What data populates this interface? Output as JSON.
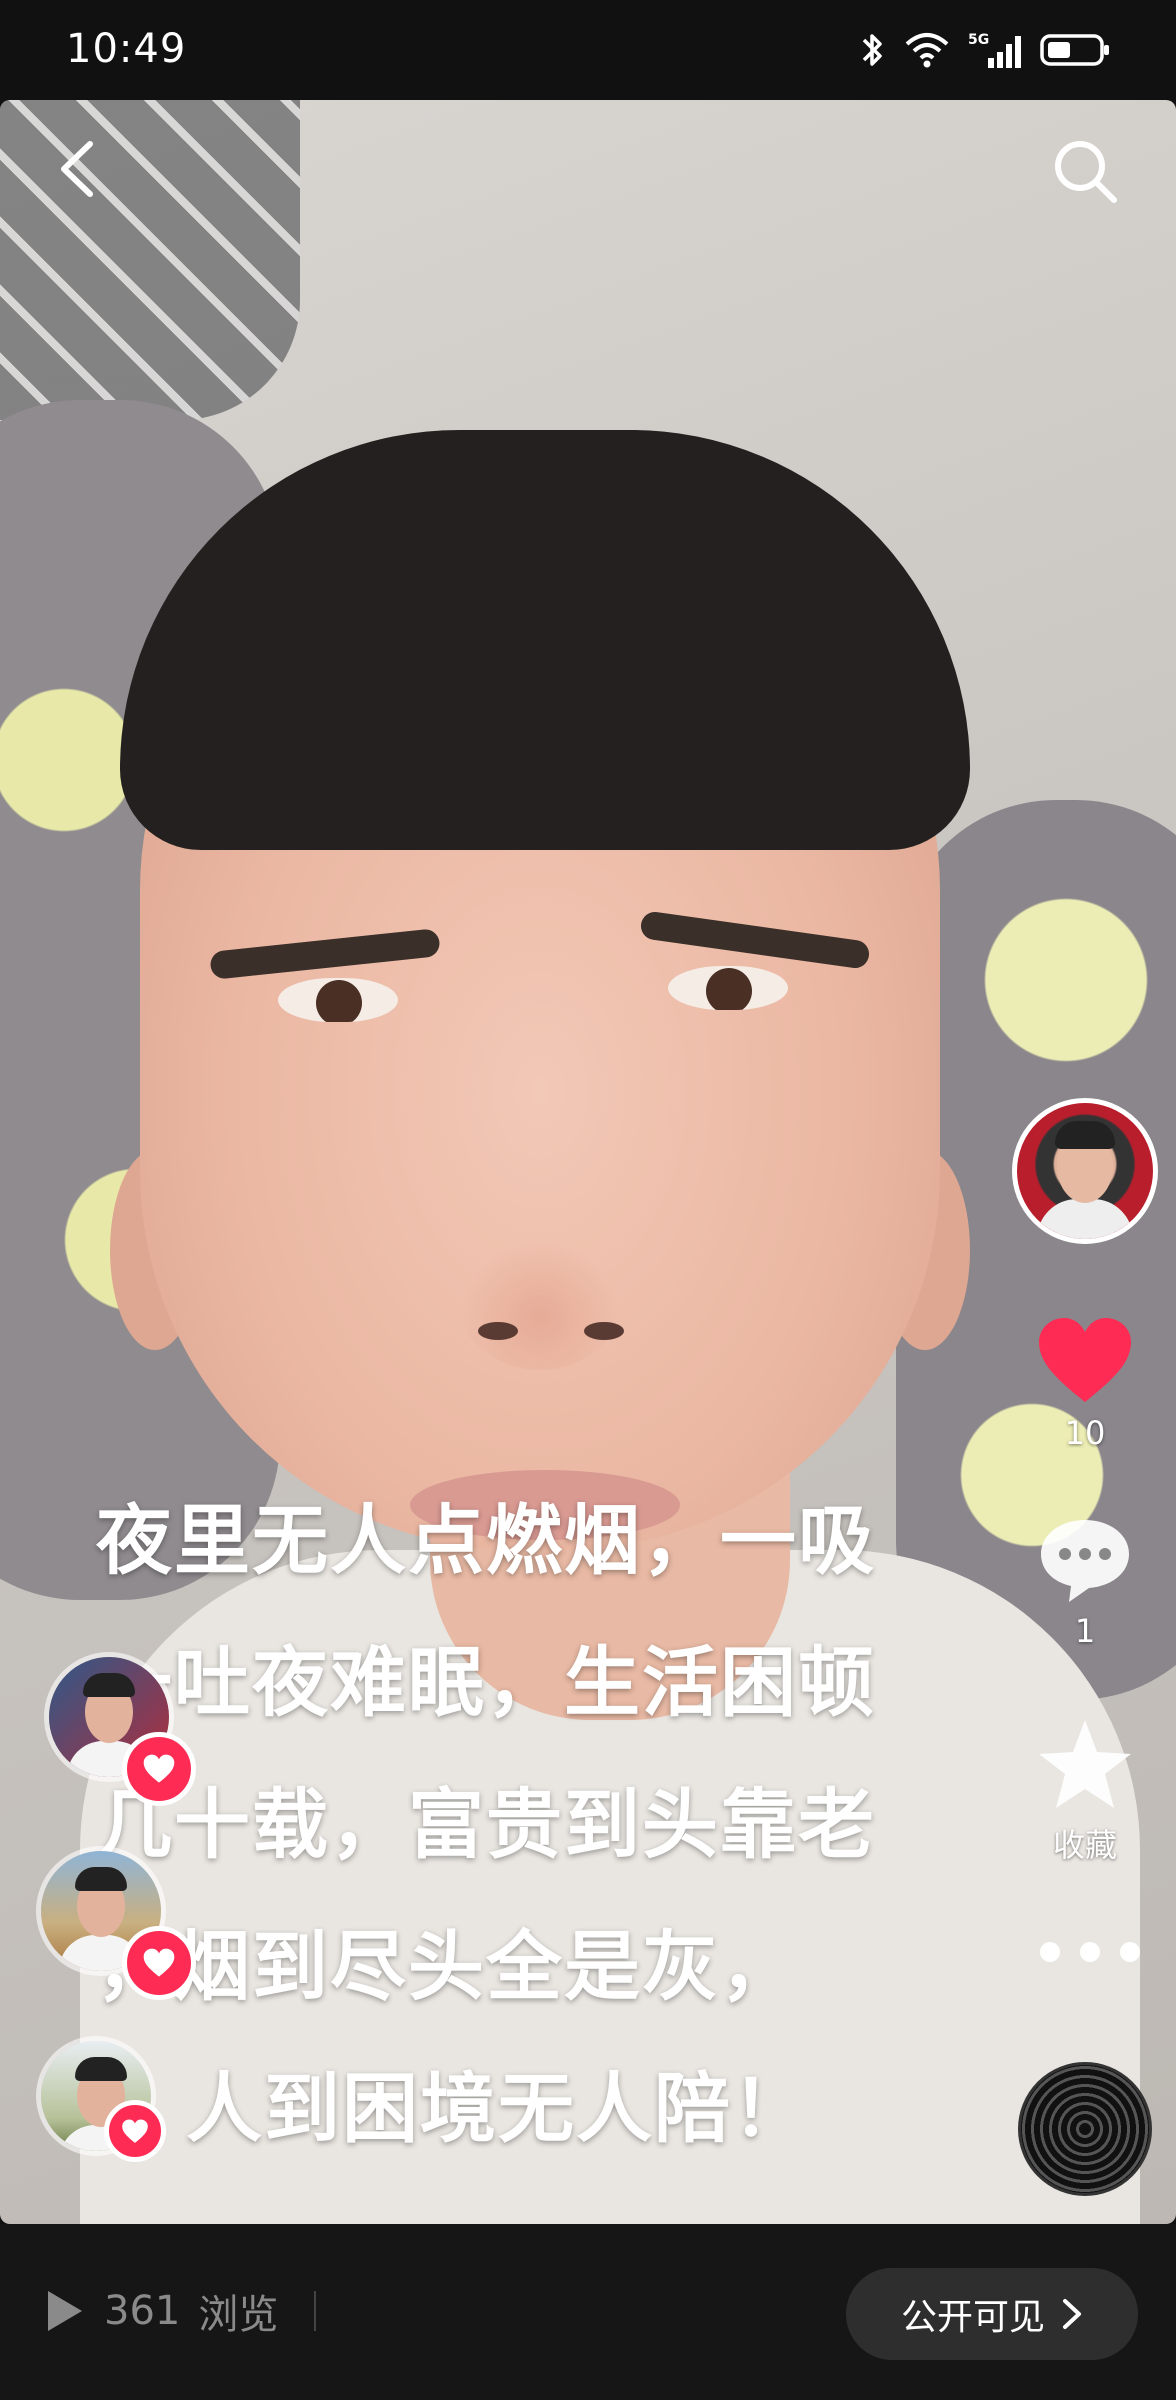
{
  "status_bar": {
    "time": "10:49",
    "network": "5G"
  },
  "video": {
    "caption_lines": [
      "夜里无人点燃烟，一吸",
      "一吐夜难眠，生活困顿",
      "几十载，富贵到头靠老",
      "，烟到尽头全是灰，",
      "人到困境无人陪！"
    ]
  },
  "side_actions": {
    "like_count": "10",
    "comment_count": "1",
    "favorite_label": "收藏"
  },
  "bottom_bar": {
    "views_count": "361",
    "views_label": "浏览",
    "visibility_label": "公开可见"
  },
  "colors": {
    "like_red": "#fe2c55",
    "bar_bg": "#161616"
  }
}
